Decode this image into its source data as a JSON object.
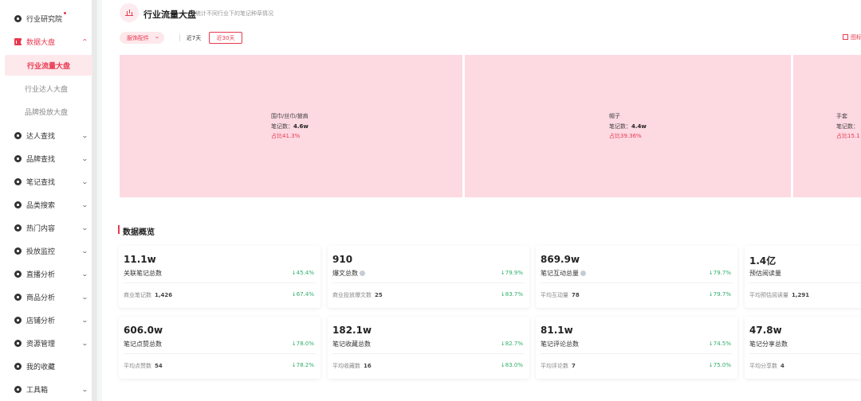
{
  "sidebar": {
    "items": [
      {
        "label": "行业研究院",
        "icon": "circle-icon",
        "has_chevron": false
      },
      {
        "label": "数据大盘",
        "icon": "bar-chart-icon",
        "chevron": "⌃"
      },
      {
        "label": "行业流量大盘"
      },
      {
        "label": "行业达人大盘"
      },
      {
        "label": "品牌投放大盘"
      },
      {
        "label": "达人查找",
        "chevron": "⌄"
      },
      {
        "label": "品牌查找",
        "chevron": "⌄"
      },
      {
        "label": "笔记查找",
        "chevron": "⌄"
      },
      {
        "label": "品类搜索",
        "chevron": "⌄"
      },
      {
        "label": "热门内容",
        "chevron": "⌄"
      },
      {
        "label": "投放监控",
        "chevron": "⌄"
      },
      {
        "label": "直播分析",
        "chevron": "⌄"
      },
      {
        "label": "商品分析",
        "chevron": "⌄"
      },
      {
        "label": "店铺分析",
        "chevron": "⌄"
      },
      {
        "label": "资源管理",
        "chevron": "⌄"
      },
      {
        "label": "我的收藏"
      },
      {
        "label": "工具箱",
        "chevron": "⌄"
      }
    ]
  },
  "header": {
    "title": "行业流量大盘",
    "subtitle": "统计不同行业下的笔记种草情况"
  },
  "filters": {
    "category": "服饰配件",
    "chevron": "⌄",
    "range_7": "近7天",
    "range_30": "近30天",
    "corner_link": "图标"
  },
  "treemap": [
    {
      "name": "围巾/丝巾/披肩",
      "count_label": "笔记数：",
      "count": "4.6w",
      "ratio": "占比41.3%"
    },
    {
      "name": "帽子",
      "count_label": "笔记数：",
      "count": "4.4w",
      "ratio": "占比39.36%"
    },
    {
      "name": "手套",
      "count_label": "笔记数：",
      "count": "",
      "ratio": "占比15.1"
    }
  ],
  "overview": {
    "title": "数据概览",
    "cards": [
      {
        "value": "11.1w",
        "label": "关联笔记总数",
        "change": "↓45.4%",
        "sub_label": "商业笔记数",
        "sub_value": "1,426",
        "sub_change": "↓67.4%",
        "info": false
      },
      {
        "value": "910",
        "label": "爆文总数",
        "change": "↓79.9%",
        "sub_label": "商业投放爆文数",
        "sub_value": "25",
        "sub_change": "↓83.7%",
        "info": true
      },
      {
        "value": "869.9w",
        "label": "笔记互动总量",
        "change": "↓79.7%",
        "sub_label": "平均互动量",
        "sub_value": "78",
        "sub_change": "↓79.7%",
        "info": true
      },
      {
        "value": "1.4亿",
        "label": "预估阅读量",
        "change": "",
        "sub_label": "平均预估阅读量",
        "sub_value": "1,291",
        "sub_change": "",
        "info": false
      },
      {
        "value": "606.0w",
        "label": "笔记点赞总数",
        "change": "↓78.0%",
        "sub_label": "平均点赞数",
        "sub_value": "54",
        "sub_change": "↓78.2%",
        "info": false
      },
      {
        "value": "182.1w",
        "label": "笔记收藏总数",
        "change": "↓82.7%",
        "sub_label": "平均收藏数",
        "sub_value": "16",
        "sub_change": "↓83.0%",
        "info": false
      },
      {
        "value": "81.1w",
        "label": "笔记评论总数",
        "change": "↓74.5%",
        "sub_label": "平均评论数",
        "sub_value": "7",
        "sub_change": "↓75.0%",
        "info": false
      },
      {
        "value": "47.8w",
        "label": "笔记分享总数",
        "change": "",
        "sub_label": "平均分享数",
        "sub_value": "4",
        "sub_change": "",
        "info": false
      }
    ]
  },
  "colors": {
    "accent": "#e8394f",
    "tile": "#fdd9e2",
    "down": "#2fae6a"
  }
}
